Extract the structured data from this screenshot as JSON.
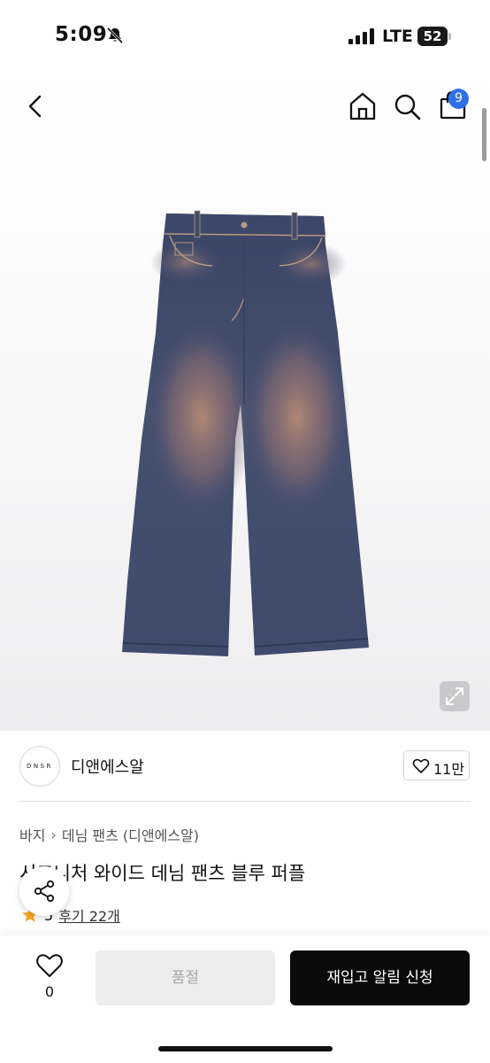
{
  "status": {
    "time": "5:09",
    "network": "LTE",
    "battery": "52",
    "icons": [
      "bell-slash-icon",
      "signal-icon",
      "battery-icon"
    ]
  },
  "header": {
    "icons": [
      "chevron-left-icon",
      "home-icon",
      "search-icon",
      "bag-icon"
    ],
    "cart_count": "9"
  },
  "product": {
    "image_icon": "expand-icon",
    "brand": {
      "logo_text": "DNSR",
      "name": "디앤에스알",
      "likes": "11만"
    },
    "breadcrumb": [
      "바지",
      "데님 팬츠 (디앤에스알)"
    ],
    "title": "시그니처 와이드 데님 팬츠 블루 퍼플",
    "rating": "5",
    "reviews_label": "후기 22개"
  },
  "bottom": {
    "wish_count": "0",
    "soldout_label": "품절",
    "restock_label": "재입고 알림 신청"
  },
  "colors": {
    "accent": "#2f6fea",
    "star": "#f5a623",
    "primary_button": "#0b0b0b",
    "disabled_button": "#ededed"
  }
}
